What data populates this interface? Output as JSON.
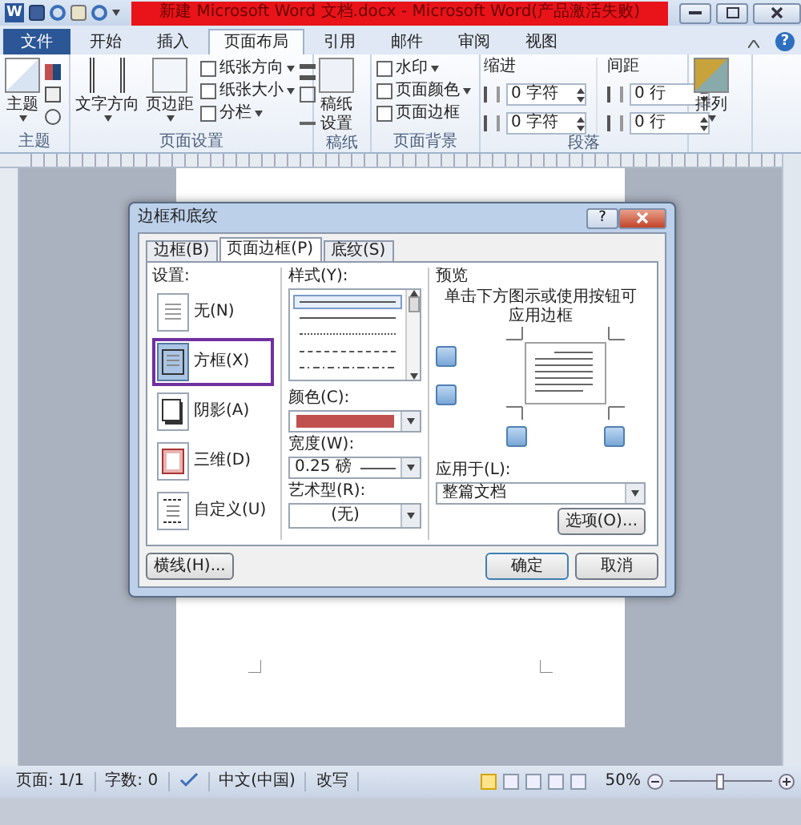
{
  "window": {
    "app_icon": "W",
    "title": "新建 Microsoft Word 文档.docx - Microsoft Word(产品激活失败)",
    "help": "?"
  },
  "ribbon_tabs": [
    {
      "label": "文件",
      "kind": "file",
      "selected": false
    },
    {
      "label": "开始",
      "kind": "tab",
      "selected": false
    },
    {
      "label": "插入",
      "kind": "tab",
      "selected": false
    },
    {
      "label": "页面布局",
      "kind": "tab",
      "selected": true
    },
    {
      "label": "引用",
      "kind": "tab",
      "selected": false
    },
    {
      "label": "邮件",
      "kind": "tab",
      "selected": false
    },
    {
      "label": "审阅",
      "kind": "tab",
      "selected": false
    },
    {
      "label": "视图",
      "kind": "tab",
      "selected": false
    }
  ],
  "ribbon": {
    "theme_group": {
      "label": "主题",
      "button": "主题"
    },
    "page_setup": {
      "label": "页面设置",
      "large_buttons": [
        "文字方向",
        "页边距"
      ],
      "small_buttons": [
        "纸张方向",
        "纸张大小",
        "分栏"
      ]
    },
    "draft": {
      "label": "稿纸",
      "button": "稿纸设置"
    },
    "page_background": {
      "label": "页面背景",
      "buttons": [
        "水印",
        "页面颜色",
        "页面边框"
      ]
    },
    "paragraph": {
      "label": "段落",
      "indent_label": "缩进",
      "spacing_label": "间距",
      "indent_fields": [
        "0 字符",
        "0 字符"
      ],
      "spacing_fields": [
        "0 行",
        "0 行"
      ]
    },
    "arrange": {
      "button": "排列"
    }
  },
  "dialog": {
    "title": "边框和底纹",
    "help": "?",
    "tabs": [
      {
        "label": "边框(B)",
        "selected": false
      },
      {
        "label": "页面边框(P)",
        "selected": true
      },
      {
        "label": "底纹(S)",
        "selected": false
      }
    ],
    "settings_label": "设置:",
    "settings": [
      {
        "label": "无(N)",
        "kind": "none",
        "selected": false
      },
      {
        "label": "方框(X)",
        "kind": "box",
        "selected": true
      },
      {
        "label": "阴影(A)",
        "kind": "shadow",
        "selected": false
      },
      {
        "label": "三维(D)",
        "kind": "threed",
        "selected": false
      },
      {
        "label": "自定义(U)",
        "kind": "custom",
        "selected": false
      }
    ],
    "style_label": "样式(Y):",
    "border_styles": [
      {
        "kind": "solid",
        "selected": true
      },
      {
        "kind": "solid",
        "selected": false
      },
      {
        "kind": "dotted",
        "selected": false
      },
      {
        "kind": "dashed",
        "selected": false
      },
      {
        "kind": "dashdot",
        "selected": false
      }
    ],
    "color_label": "颜色(C):",
    "color": "#c0504d",
    "width_label": "宽度(W):",
    "width_value": "0.25 磅",
    "art_label": "艺术型(R):",
    "art_value": "(无)",
    "preview_label": "预览",
    "preview_hint": "单击下方图示或使用按钮可应用边框",
    "apply_label": "应用于(L):",
    "apply_value": "整篇文档",
    "options_button": "选项(O)...",
    "hline_button": "横线(H)...",
    "ok_button": "确定",
    "cancel_button": "取消"
  },
  "status_bar": {
    "page": "页面: 1/1",
    "words": "字数: 0",
    "language": "中文(中国)",
    "mode": "改写",
    "zoom": {
      "reading": "50%",
      "level": 0.5
    }
  }
}
